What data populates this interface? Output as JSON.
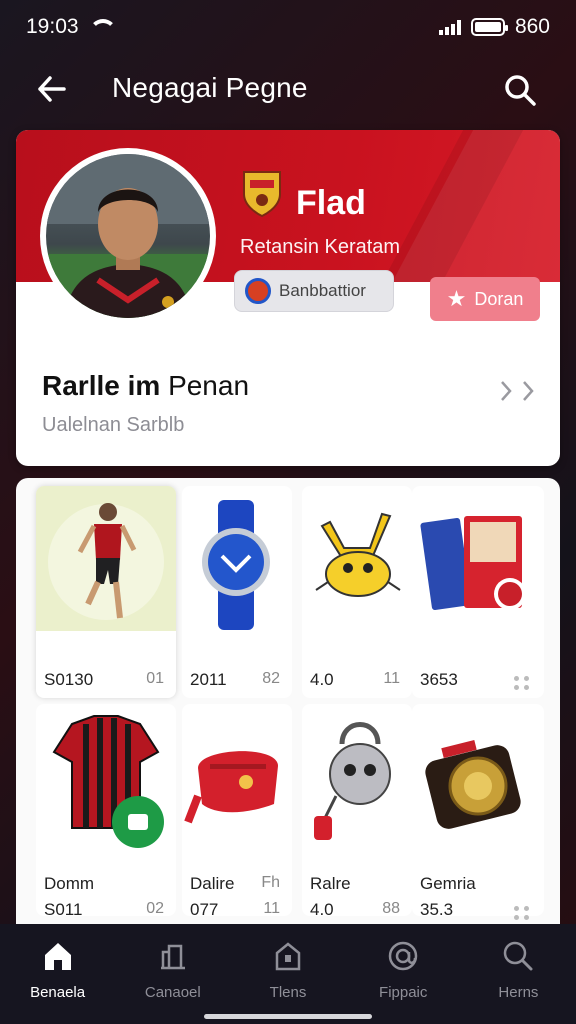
{
  "status_bar": {
    "time": "19:03",
    "battery": "860",
    "wifi_icon": "wifi-icon",
    "signal_icon": "signal-icon",
    "battery_icon": "battery-icon"
  },
  "header": {
    "title": "Negagai Pegne",
    "back_icon": "arrow-left-icon",
    "search_icon": "search-icon"
  },
  "profile": {
    "name": "Flad",
    "team": "Retansin Keratam",
    "tag": "Banbbattior",
    "follow_label": "Doran",
    "heading_bold": "Rarlle im",
    "heading_rest": "Penan",
    "subtitle": "Ualelnan Sarblb",
    "chevron": ">>",
    "colors": {
      "banner": "#c9121f",
      "follow": "#f07f8c"
    }
  },
  "items": [
    {
      "title": "",
      "price": "S0130",
      "meta": "01"
    },
    {
      "title": "",
      "price": "2011",
      "meta": "82"
    },
    {
      "title": "",
      "price": "4.0",
      "meta": "11"
    },
    {
      "title": "",
      "price": "3653",
      "meta": ""
    },
    {
      "title": "Domm",
      "price": "S011",
      "meta": "02"
    },
    {
      "title": "Dalire",
      "price": "077",
      "meta": "11",
      "meta_top": "Fh"
    },
    {
      "title": "Ralre",
      "price": "4.0",
      "meta": "88"
    },
    {
      "title": "Gemria",
      "price": "35.3",
      "meta": ""
    }
  ],
  "nav": [
    {
      "label": "Benaela",
      "icon": "home-icon",
      "active": true
    },
    {
      "label": "Canaoel",
      "icon": "bookmark-icon",
      "active": false
    },
    {
      "label": "Tlens",
      "icon": "house-icon",
      "active": false
    },
    {
      "label": "Fippaic",
      "icon": "at-icon",
      "active": false
    },
    {
      "label": "Herns",
      "icon": "search-icon",
      "active": false
    }
  ]
}
